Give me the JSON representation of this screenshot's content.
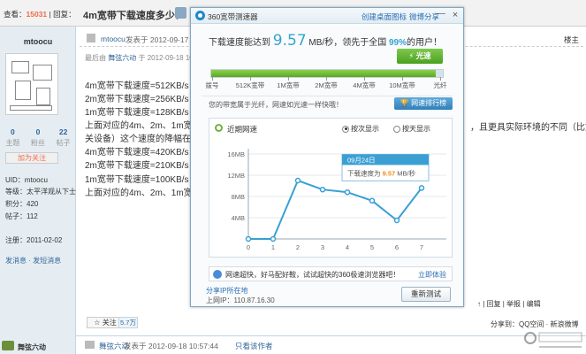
{
  "forum": {
    "views_label": "查看：",
    "views_count": "15031",
    "replies_label": "回复：",
    "replies_count": "38",
    "views_sep": "|",
    "thread_title": "4m宽带下载速度多少？",
    "post_author": "mtoocu",
    "post_date": "发表于 2012-09-17 1",
    "post_floor": "楼主",
    "edit_note_prefix": "最后由",
    "edit_note_name": "舞弦六动",
    "edit_note_suffix": "于 2012-09-18 10:",
    "lines": [
      "4m宽带下载速度=512KB/s",
      "2m宽带下载速度=256KB/s",
      "1m宽带下载速度=128KB/s",
      "上面对应的4m、2m、1m宽带",
      "关设备）这个速度的降幅在是",
      "4m宽带下载速度=420KB/s",
      "2m宽带下载速度=210KB/s",
      "1m宽带下载速度=100KB/s",
      "上面对应的4m、2m、1m宽带"
    ],
    "right_snippet": "，且更具实际环境的不同（比如干扰",
    "user": {
      "name": "mtoocu",
      "stats": [
        {
          "value": "0",
          "label": "主题"
        },
        {
          "value": "0",
          "label": "粉丝"
        },
        {
          "value": "22",
          "label": "帖子"
        }
      ],
      "follow_label": "加为关注",
      "info": [
        "UID：mtoocu",
        "等级：太平洋观从下士",
        "积分：420",
        "帖子：112",
        "注册：2011-02-02"
      ],
      "links": "发消息  ·  发短消息"
    },
    "actions": "↑ | 回复 | 举报 | 编辑",
    "share": "分享到：QQ空间 · 新浪微博",
    "fav_label": "关注",
    "fav_count": "5.7万",
    "foot_left": "舞弦六动",
    "foot_author": "舞弦六动",
    "foot_date": "发表于 2012-09-18 10:57:44",
    "foot_only": "只看该作者"
  },
  "speedtest": {
    "title": "360宽带测速器",
    "link_desktop": "创建桌面图标",
    "link_weibo": "微博分享",
    "minimize": "—",
    "close": "×",
    "speed_prefix": "下载速度能达到",
    "speed_value": "9.57",
    "speed_unit": "MB/秒，领先于全国",
    "percent": "99%",
    "speed_suffix": "的用户！",
    "turbo_label": "⚡ 光速",
    "bar_level": 0.97,
    "ticks": [
      "拨号",
      "512K宽带",
      "1M宽带",
      "2M宽带",
      "4M宽带",
      "10M宽带",
      "光纤"
    ],
    "desc": "您的带宽属于光纤，网速如光速一样快哦！",
    "rank_label": "网速排行榜",
    "chart_title": "近期网速",
    "radio_each": "按次显示",
    "radio_day": "按天显示",
    "ad_text": "网速超快，好马配好鞍，试试超快的360极速浏览器吧！",
    "ad_link": "立即体验",
    "ip_share": "分享IP所在地",
    "ip_line": "上网IP：110.87.16.30",
    "retest_label": "重新测试"
  },
  "chart_data": {
    "type": "line",
    "title": "近期网速",
    "x": [
      0,
      1,
      2,
      3,
      4,
      5,
      6,
      7
    ],
    "xticks": [
      "0",
      "1",
      "2",
      "3",
      "4",
      "5",
      "6",
      "7"
    ],
    "yticks": [
      "4MB",
      "8MB",
      "12MB",
      "16MB"
    ],
    "values": [
      0,
      0,
      11,
      9.3,
      8.8,
      7.2,
      3.5,
      9.6
    ],
    "ylim": [
      0,
      16
    ],
    "xlim": [
      0,
      8
    ],
    "tooltip": {
      "date": "09月24日",
      "text_prefix": "下载速度为",
      "value": "9.57",
      "unit": "MB/秒"
    },
    "color": "#3b9fd4"
  },
  "colors": {
    "accent": "#36a4ce",
    "turbo": "#5aa823",
    "link": "#2a6fb3",
    "count": "#f26c4f"
  }
}
